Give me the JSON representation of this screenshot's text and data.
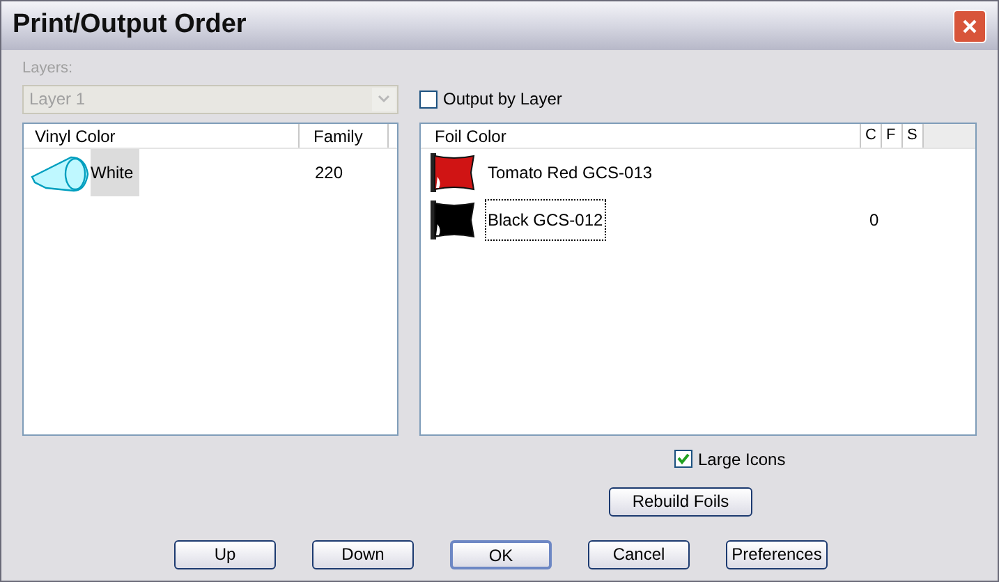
{
  "window": {
    "title": "Print/Output Order"
  },
  "layers": {
    "label": "Layers:",
    "value": "Layer 1",
    "disabled": true
  },
  "output_by_layer": {
    "label": "Output by Layer",
    "checked": false
  },
  "vinyl_list": {
    "columns": [
      "Vinyl Color",
      "Family"
    ],
    "rows": [
      {
        "name": "White",
        "family": "220",
        "selected": true
      }
    ]
  },
  "foil_list": {
    "columns": [
      "Foil Color",
      "C",
      "F",
      "S"
    ],
    "rows": [
      {
        "name": "Tomato Red GCS-013",
        "color": "#d01414",
        "focused": false
      },
      {
        "name": "Black GCS-012",
        "color": "#000000",
        "values": [
          "0"
        ],
        "focused": true
      }
    ]
  },
  "large_icons": {
    "label": "Large Icons",
    "checked": true
  },
  "rebuild_button": "Rebuild Foils",
  "buttons": [
    {
      "label": "Up",
      "default": false
    },
    {
      "label": "Down",
      "default": false
    },
    {
      "label": "OK",
      "default": true
    },
    {
      "label": "Cancel",
      "default": false
    },
    {
      "label": "Preferences",
      "default": false
    }
  ]
}
